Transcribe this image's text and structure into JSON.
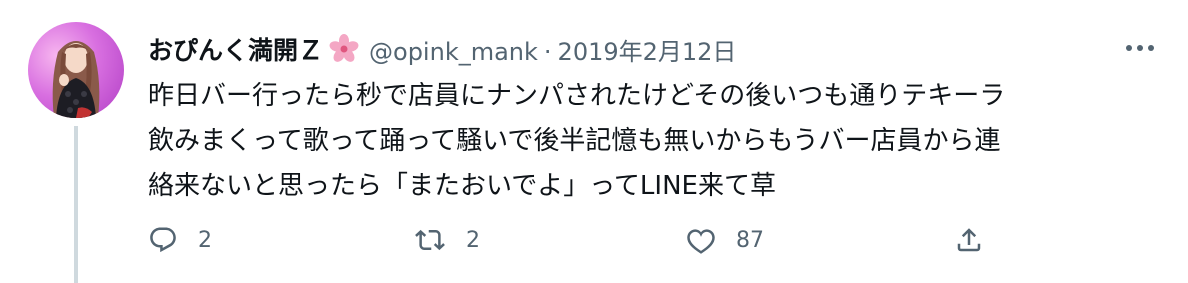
{
  "tweet": {
    "display_name": "おぴんく満開Ｚ",
    "name_emoji_icon": "cherry-blossom-icon",
    "handle": "@opink_mank",
    "separator": "·",
    "date": "2019年2月12日",
    "text_lines": [
      "昨日バー行ったら秒で店員にナンパされたけどその後いつも通りテキーラ",
      "飲みまくって歌って踊って騒いで後半記憶も無いからもうバー店員から連",
      "絡来ないと思ったら「またおいでよ」ってLINE来て草"
    ]
  },
  "actions": {
    "reply_icon": "reply-icon",
    "reply_count": "2",
    "retweet_icon": "retweet-icon",
    "retweet_count": "2",
    "like_icon": "heart-icon",
    "like_count": "87",
    "share_icon": "share-icon"
  },
  "colors": {
    "primary_text": "#0f1419",
    "secondary_text": "#536471",
    "thread_line": "#cfd9de",
    "avatar_bg": "#d86fe0"
  }
}
